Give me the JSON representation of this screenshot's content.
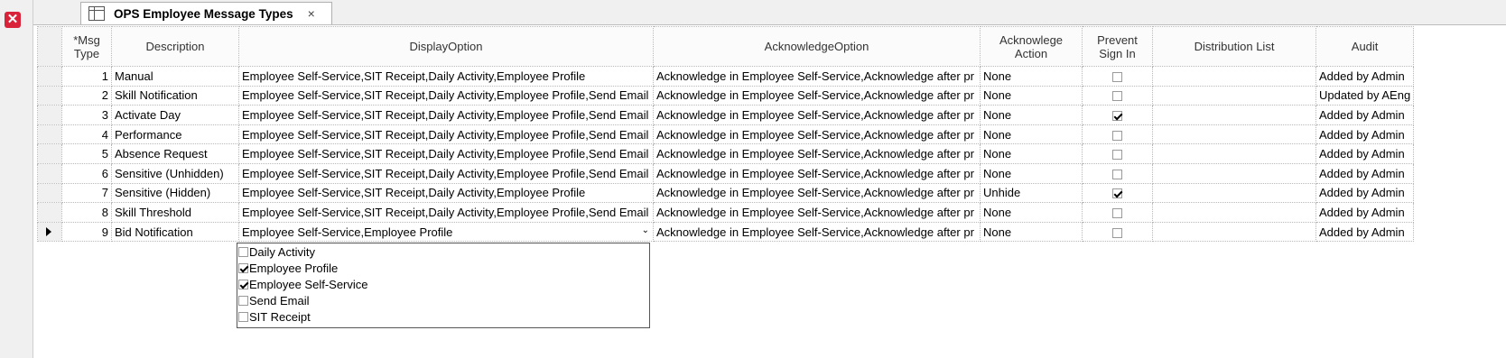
{
  "tab": {
    "title": "OPS Employee Message Types",
    "close": "×"
  },
  "columns": [
    "*Msg Type",
    "Description",
    "DisplayOption",
    "AcknowledgeOption",
    "Acknowlege Action",
    "Prevent Sign In",
    "Distribution List",
    "Audit"
  ],
  "rows": [
    {
      "type": "1",
      "description": "Manual",
      "display": "Employee Self-Service,SIT Receipt,Daily Activity,Employee Profile",
      "ack": "Acknowledge in Employee Self-Service,Acknowledge after pr",
      "action": "None",
      "prevent": false,
      "dist": "",
      "audit": "Added by Admin"
    },
    {
      "type": "2",
      "description": "Skill Notification",
      "display": "Employee Self-Service,SIT Receipt,Daily Activity,Employee Profile,Send Email",
      "ack": "Acknowledge in Employee Self-Service,Acknowledge after pr",
      "action": "None",
      "prevent": false,
      "dist": "",
      "audit": "Updated by AEng"
    },
    {
      "type": "3",
      "description": "Activate Day",
      "display": "Employee Self-Service,SIT Receipt,Daily Activity,Employee Profile,Send Email",
      "ack": "Acknowledge in Employee Self-Service,Acknowledge after pr",
      "action": "None",
      "prevent": true,
      "dist": "",
      "audit": "Added by Admin"
    },
    {
      "type": "4",
      "description": "Performance",
      "display": "Employee Self-Service,SIT Receipt,Daily Activity,Employee Profile,Send Email",
      "ack": "Acknowledge in Employee Self-Service,Acknowledge after pr",
      "action": "None",
      "prevent": false,
      "dist": "",
      "audit": "Added by Admin"
    },
    {
      "type": "5",
      "description": "Absence Request",
      "display": "Employee Self-Service,SIT Receipt,Daily Activity,Employee Profile,Send Email",
      "ack": "Acknowledge in Employee Self-Service,Acknowledge after pr",
      "action": "None",
      "prevent": false,
      "dist": "",
      "audit": "Added by Admin"
    },
    {
      "type": "6",
      "description": "Sensitive (Unhidden)",
      "display": "Employee Self-Service,SIT Receipt,Daily Activity,Employee Profile,Send Email",
      "ack": "Acknowledge in Employee Self-Service,Acknowledge after pr",
      "action": "None",
      "prevent": false,
      "dist": "",
      "audit": "Added by Admin"
    },
    {
      "type": "7",
      "description": "Sensitive (Hidden)",
      "display": "Employee Self-Service,SIT Receipt,Daily Activity,Employee Profile",
      "ack": "Acknowledge in Employee Self-Service,Acknowledge after pr",
      "action": "Unhide",
      "prevent": true,
      "dist": "",
      "audit": "Added by Admin"
    },
    {
      "type": "8",
      "description": "Skill Threshold",
      "display": "Employee Self-Service,SIT Receipt,Daily Activity,Employee Profile,Send Email",
      "ack": "Acknowledge in Employee Self-Service,Acknowledge after pr",
      "action": "None",
      "prevent": false,
      "dist": "",
      "audit": "Added by Admin"
    },
    {
      "type": "9",
      "description": "Bid Notification",
      "display": "Employee Self-Service,Employee Profile",
      "ack": "Acknowledge in Employee Self-Service,Acknowledge after pr",
      "action": "None",
      "prevent": false,
      "dist": "",
      "audit": "Added by Admin",
      "current": true
    }
  ],
  "dropdown": [
    {
      "label": "Daily Activity",
      "checked": false
    },
    {
      "label": "Employee Profile",
      "checked": true
    },
    {
      "label": "Employee Self-Service",
      "checked": true
    },
    {
      "label": "Send Email",
      "checked": false
    },
    {
      "label": "SIT Receipt",
      "checked": false
    }
  ],
  "colors": {
    "close_button": "#d9233a"
  }
}
